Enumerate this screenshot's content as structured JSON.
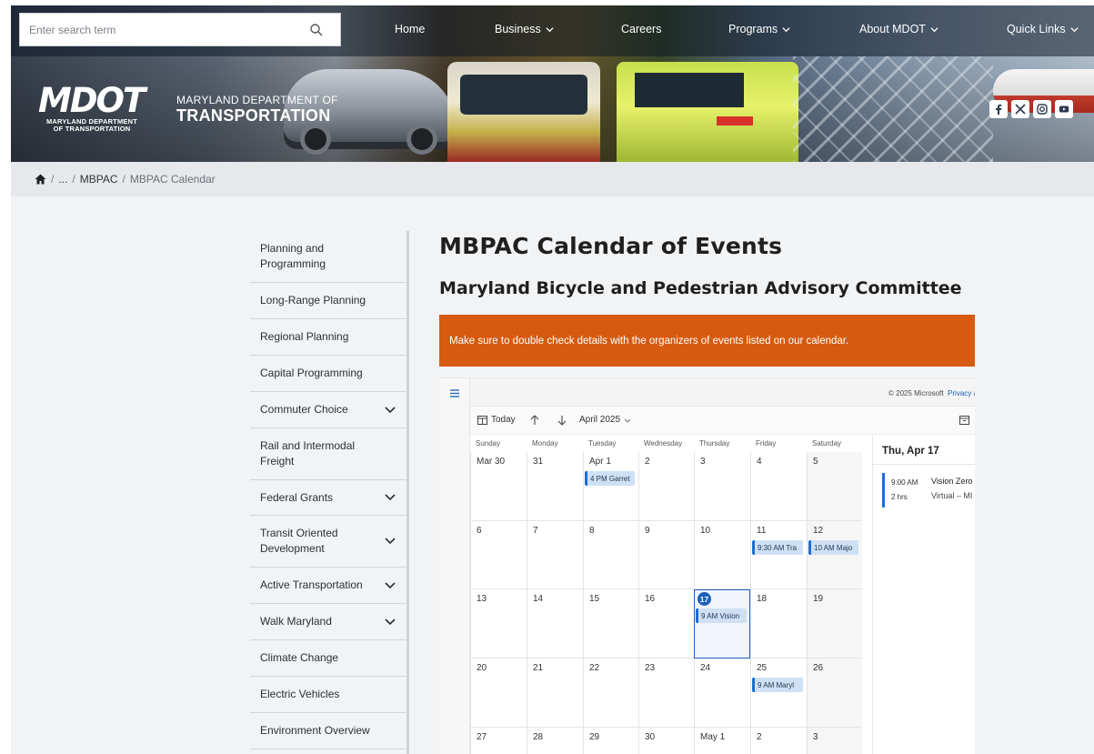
{
  "header": {
    "search_placeholder": "Enter search term",
    "nav": [
      {
        "label": "Home",
        "has_menu": false
      },
      {
        "label": "Business",
        "has_menu": true
      },
      {
        "label": "Careers",
        "has_menu": false
      },
      {
        "label": "Programs",
        "has_menu": true
      },
      {
        "label": "About MDOT",
        "has_menu": true
      },
      {
        "label": "Quick Links",
        "has_menu": true
      }
    ],
    "logo": {
      "mark": "MDOT",
      "line1": "MARYLAND DEPARTMENT",
      "line2": "OF TRANSPORTATION"
    },
    "dept": {
      "line1": "MARYLAND DEPARTMENT OF",
      "line2": "TRANSPORTATION"
    },
    "social": [
      "facebook-icon",
      "x-icon",
      "instagram-icon",
      "youtube-icon"
    ]
  },
  "breadcrumb": {
    "ellipsis": "...",
    "parent": "MBPAC",
    "current": "MBPAC Calendar"
  },
  "sidebar": {
    "items": [
      {
        "label": "Planning and Programming",
        "has_children": false
      },
      {
        "label": "Long-Range Planning",
        "has_children": false
      },
      {
        "label": "Regional Planning",
        "has_children": false
      },
      {
        "label": "Capital Programming",
        "has_children": false
      },
      {
        "label": "Commuter Choice",
        "has_children": true
      },
      {
        "label": "Rail and Intermodal Freight",
        "has_children": false
      },
      {
        "label": "Federal Grants",
        "has_children": true
      },
      {
        "label": "Transit Oriented Development",
        "has_children": true
      },
      {
        "label": "Active Transportation",
        "has_children": true
      },
      {
        "label": "Walk Maryland",
        "has_children": true
      },
      {
        "label": "Climate Change",
        "has_children": false
      },
      {
        "label": "Electric Vehicles",
        "has_children": false
      },
      {
        "label": "Environment Overview",
        "has_children": false
      }
    ]
  },
  "main": {
    "title": "MBPAC Calendar of Events",
    "subtitle": "Maryland Bicycle and Pedestrian Advisory Committee",
    "notice": "Make sure to double check details with the organizers of events listed on our calendar."
  },
  "calendar": {
    "copyright": "© 2025 Microsoft",
    "privacy_link": "Privacy & Cookies",
    "today_label": "Today",
    "month_label": "April 2025",
    "weekdays": [
      "Sunday",
      "Monday",
      "Tuesday",
      "Wednesday",
      "Thursday",
      "Friday",
      "Saturday"
    ],
    "weeks": [
      [
        {
          "day": "Mar 30"
        },
        {
          "day": "31"
        },
        {
          "day": "Apr 1",
          "event": "4 PM Garret"
        },
        {
          "day": "2"
        },
        {
          "day": "3"
        },
        {
          "day": "4"
        },
        {
          "day": "5"
        }
      ],
      [
        {
          "day": "6"
        },
        {
          "day": "7"
        },
        {
          "day": "8"
        },
        {
          "day": "9"
        },
        {
          "day": "10"
        },
        {
          "day": "11",
          "event": "9:30 AM Tra"
        },
        {
          "day": "12",
          "event": "10 AM Majo"
        }
      ],
      [
        {
          "day": "13"
        },
        {
          "day": "14"
        },
        {
          "day": "15"
        },
        {
          "day": "16"
        },
        {
          "day": "17",
          "today": true,
          "event": "9 AM Vision"
        },
        {
          "day": "18"
        },
        {
          "day": "19"
        }
      ],
      [
        {
          "day": "20"
        },
        {
          "day": "21"
        },
        {
          "day": "22"
        },
        {
          "day": "23"
        },
        {
          "day": "24"
        },
        {
          "day": "25",
          "event": "9 AM Maryl"
        },
        {
          "day": "26"
        }
      ],
      [
        {
          "day": "27"
        },
        {
          "day": "28"
        },
        {
          "day": "29"
        },
        {
          "day": "30"
        },
        {
          "day": "May 1"
        },
        {
          "day": "2"
        },
        {
          "day": "3"
        }
      ]
    ],
    "agenda": {
      "date": "Thu, Apr 17",
      "time": "9:00 AM",
      "duration": "2 hrs",
      "title": "Vision Zero",
      "location": "Virtual – MI"
    }
  },
  "colors": {
    "notice_bg": "#d65a0f",
    "event_bar": "#1d6fd1",
    "event_bg": "#cfe0f5",
    "today": "#1d5fb8"
  }
}
